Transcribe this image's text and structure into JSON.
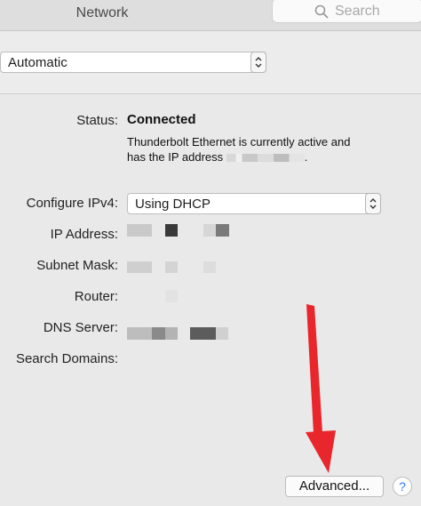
{
  "window": {
    "title": "Network"
  },
  "search": {
    "placeholder": "Search"
  },
  "location": {
    "value": "Automatic"
  },
  "status": {
    "label": "Status:",
    "value": "Connected",
    "description_1": "Thunderbolt Ethernet is currently active and",
    "description_2": "has the IP address",
    "description_end": "."
  },
  "config": {
    "label": "Configure IPv4:",
    "value": "Using DHCP"
  },
  "fields": {
    "ip_label": "IP Address:",
    "subnet_label": "Subnet Mask:",
    "router_label": "Router:",
    "dns_label": "DNS Server:",
    "search_domains_label": "Search Domains:"
  },
  "buttons": {
    "advanced": "Advanced...",
    "help": "?"
  },
  "colors": {
    "annotation_arrow": "#e8262c",
    "accent": "#3478f6"
  }
}
